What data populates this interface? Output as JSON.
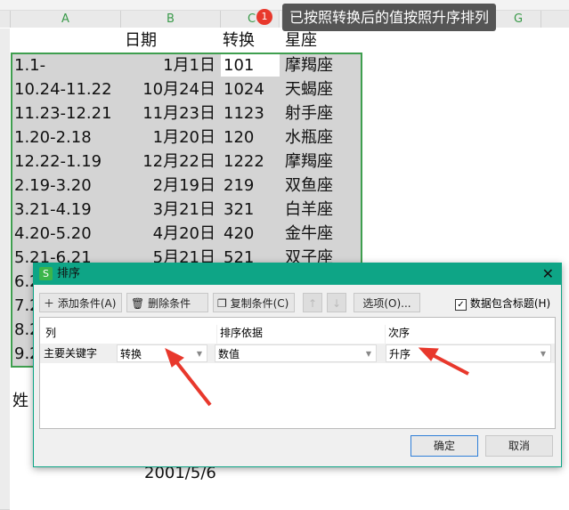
{
  "columns": [
    "A",
    "B",
    "C",
    "G"
  ],
  "headers": {
    "date": "日期",
    "convert": "转换",
    "sign": "星座"
  },
  "rows": [
    {
      "a": "1.1-",
      "b": "1月1日",
      "c": "101",
      "d": "摩羯座"
    },
    {
      "a": "10.24-11.22",
      "b": "10月24日",
      "c": "1024",
      "d": "天蝎座"
    },
    {
      "a": "11.23-12.21",
      "b": "11月23日",
      "c": "1123",
      "d": "射手座"
    },
    {
      "a": "1.20-2.18",
      "b": "1月20日",
      "c": "120",
      "d": "水瓶座"
    },
    {
      "a": "12.22-1.19",
      "b": "12月22日",
      "c": "1222",
      "d": "摩羯座"
    },
    {
      "a": "2.19-3.20",
      "b": "2月19日",
      "c": "219",
      "d": "双鱼座"
    },
    {
      "a": "3.21-4.19",
      "b": "3月21日",
      "c": "321",
      "d": "白羊座"
    },
    {
      "a": "4.20-5.20",
      "b": "4月20日",
      "c": "420",
      "d": "金牛座"
    },
    {
      "a": "5.21-6.21",
      "b": "5月21日",
      "c": "521",
      "d": "双子座"
    },
    {
      "a": "6.2"
    },
    {
      "a": "7.2"
    },
    {
      "a": "8.2"
    },
    {
      "a": "9.2"
    }
  ],
  "below": {
    "name_label": "姓",
    "date_value": "2001/5/6"
  },
  "tooltip": {
    "badge": "1",
    "text": "已按照转换后的值按照升序排列"
  },
  "dialog": {
    "title": "排序",
    "logo": "S",
    "add": "添加条件(A)",
    "delete": "删除条件(D)",
    "copy": "复制条件(C)",
    "options": "选项(O)...",
    "has_header": "数据包含标题(H)",
    "has_header_checked": true,
    "col_header": "列",
    "basis_header": "排序依据",
    "order_header": "次序",
    "key_label": "主要关键字",
    "key_value": "转换",
    "basis_value": "数值",
    "order_value": "升序",
    "ok": "确定",
    "cancel": "取消"
  },
  "colors": {
    "accent": "#0ea586",
    "selection": "#3f9f4f",
    "arrow": "#e8382c"
  }
}
